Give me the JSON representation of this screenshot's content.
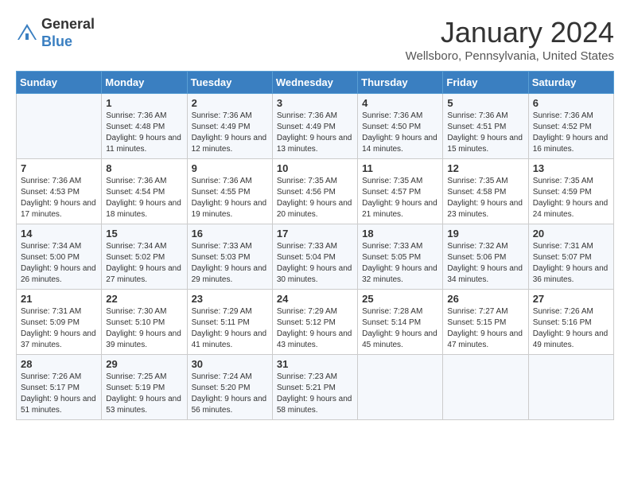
{
  "header": {
    "logo_line1": "General",
    "logo_line2": "Blue",
    "month": "January 2024",
    "location": "Wellsboro, Pennsylvania, United States"
  },
  "days_of_week": [
    "Sunday",
    "Monday",
    "Tuesday",
    "Wednesday",
    "Thursday",
    "Friday",
    "Saturday"
  ],
  "weeks": [
    [
      {
        "day": "",
        "sunrise": "",
        "sunset": "",
        "daylight": ""
      },
      {
        "day": "1",
        "sunrise": "Sunrise: 7:36 AM",
        "sunset": "Sunset: 4:48 PM",
        "daylight": "Daylight: 9 hours and 11 minutes."
      },
      {
        "day": "2",
        "sunrise": "Sunrise: 7:36 AM",
        "sunset": "Sunset: 4:49 PM",
        "daylight": "Daylight: 9 hours and 12 minutes."
      },
      {
        "day": "3",
        "sunrise": "Sunrise: 7:36 AM",
        "sunset": "Sunset: 4:49 PM",
        "daylight": "Daylight: 9 hours and 13 minutes."
      },
      {
        "day": "4",
        "sunrise": "Sunrise: 7:36 AM",
        "sunset": "Sunset: 4:50 PM",
        "daylight": "Daylight: 9 hours and 14 minutes."
      },
      {
        "day": "5",
        "sunrise": "Sunrise: 7:36 AM",
        "sunset": "Sunset: 4:51 PM",
        "daylight": "Daylight: 9 hours and 15 minutes."
      },
      {
        "day": "6",
        "sunrise": "Sunrise: 7:36 AM",
        "sunset": "Sunset: 4:52 PM",
        "daylight": "Daylight: 9 hours and 16 minutes."
      }
    ],
    [
      {
        "day": "7",
        "sunrise": "Sunrise: 7:36 AM",
        "sunset": "Sunset: 4:53 PM",
        "daylight": "Daylight: 9 hours and 17 minutes."
      },
      {
        "day": "8",
        "sunrise": "Sunrise: 7:36 AM",
        "sunset": "Sunset: 4:54 PM",
        "daylight": "Daylight: 9 hours and 18 minutes."
      },
      {
        "day": "9",
        "sunrise": "Sunrise: 7:36 AM",
        "sunset": "Sunset: 4:55 PM",
        "daylight": "Daylight: 9 hours and 19 minutes."
      },
      {
        "day": "10",
        "sunrise": "Sunrise: 7:35 AM",
        "sunset": "Sunset: 4:56 PM",
        "daylight": "Daylight: 9 hours and 20 minutes."
      },
      {
        "day": "11",
        "sunrise": "Sunrise: 7:35 AM",
        "sunset": "Sunset: 4:57 PM",
        "daylight": "Daylight: 9 hours and 21 minutes."
      },
      {
        "day": "12",
        "sunrise": "Sunrise: 7:35 AM",
        "sunset": "Sunset: 4:58 PM",
        "daylight": "Daylight: 9 hours and 23 minutes."
      },
      {
        "day": "13",
        "sunrise": "Sunrise: 7:35 AM",
        "sunset": "Sunset: 4:59 PM",
        "daylight": "Daylight: 9 hours and 24 minutes."
      }
    ],
    [
      {
        "day": "14",
        "sunrise": "Sunrise: 7:34 AM",
        "sunset": "Sunset: 5:00 PM",
        "daylight": "Daylight: 9 hours and 26 minutes."
      },
      {
        "day": "15",
        "sunrise": "Sunrise: 7:34 AM",
        "sunset": "Sunset: 5:02 PM",
        "daylight": "Daylight: 9 hours and 27 minutes."
      },
      {
        "day": "16",
        "sunrise": "Sunrise: 7:33 AM",
        "sunset": "Sunset: 5:03 PM",
        "daylight": "Daylight: 9 hours and 29 minutes."
      },
      {
        "day": "17",
        "sunrise": "Sunrise: 7:33 AM",
        "sunset": "Sunset: 5:04 PM",
        "daylight": "Daylight: 9 hours and 30 minutes."
      },
      {
        "day": "18",
        "sunrise": "Sunrise: 7:33 AM",
        "sunset": "Sunset: 5:05 PM",
        "daylight": "Daylight: 9 hours and 32 minutes."
      },
      {
        "day": "19",
        "sunrise": "Sunrise: 7:32 AM",
        "sunset": "Sunset: 5:06 PM",
        "daylight": "Daylight: 9 hours and 34 minutes."
      },
      {
        "day": "20",
        "sunrise": "Sunrise: 7:31 AM",
        "sunset": "Sunset: 5:07 PM",
        "daylight": "Daylight: 9 hours and 36 minutes."
      }
    ],
    [
      {
        "day": "21",
        "sunrise": "Sunrise: 7:31 AM",
        "sunset": "Sunset: 5:09 PM",
        "daylight": "Daylight: 9 hours and 37 minutes."
      },
      {
        "day": "22",
        "sunrise": "Sunrise: 7:30 AM",
        "sunset": "Sunset: 5:10 PM",
        "daylight": "Daylight: 9 hours and 39 minutes."
      },
      {
        "day": "23",
        "sunrise": "Sunrise: 7:29 AM",
        "sunset": "Sunset: 5:11 PM",
        "daylight": "Daylight: 9 hours and 41 minutes."
      },
      {
        "day": "24",
        "sunrise": "Sunrise: 7:29 AM",
        "sunset": "Sunset: 5:12 PM",
        "daylight": "Daylight: 9 hours and 43 minutes."
      },
      {
        "day": "25",
        "sunrise": "Sunrise: 7:28 AM",
        "sunset": "Sunset: 5:14 PM",
        "daylight": "Daylight: 9 hours and 45 minutes."
      },
      {
        "day": "26",
        "sunrise": "Sunrise: 7:27 AM",
        "sunset": "Sunset: 5:15 PM",
        "daylight": "Daylight: 9 hours and 47 minutes."
      },
      {
        "day": "27",
        "sunrise": "Sunrise: 7:26 AM",
        "sunset": "Sunset: 5:16 PM",
        "daylight": "Daylight: 9 hours and 49 minutes."
      }
    ],
    [
      {
        "day": "28",
        "sunrise": "Sunrise: 7:26 AM",
        "sunset": "Sunset: 5:17 PM",
        "daylight": "Daylight: 9 hours and 51 minutes."
      },
      {
        "day": "29",
        "sunrise": "Sunrise: 7:25 AM",
        "sunset": "Sunset: 5:19 PM",
        "daylight": "Daylight: 9 hours and 53 minutes."
      },
      {
        "day": "30",
        "sunrise": "Sunrise: 7:24 AM",
        "sunset": "Sunset: 5:20 PM",
        "daylight": "Daylight: 9 hours and 56 minutes."
      },
      {
        "day": "31",
        "sunrise": "Sunrise: 7:23 AM",
        "sunset": "Sunset: 5:21 PM",
        "daylight": "Daylight: 9 hours and 58 minutes."
      },
      {
        "day": "",
        "sunrise": "",
        "sunset": "",
        "daylight": ""
      },
      {
        "day": "",
        "sunrise": "",
        "sunset": "",
        "daylight": ""
      },
      {
        "day": "",
        "sunrise": "",
        "sunset": "",
        "daylight": ""
      }
    ]
  ]
}
